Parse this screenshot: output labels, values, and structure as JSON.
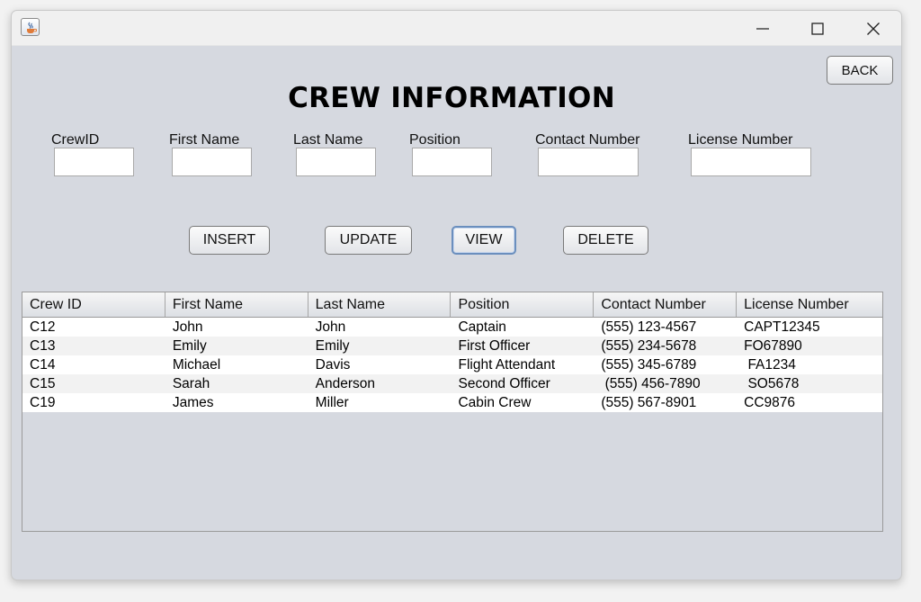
{
  "form": {
    "title": "CREW INFORMATION",
    "back_label": "BACK",
    "fields": [
      {
        "label": "CrewID",
        "value": ""
      },
      {
        "label": "First Name",
        "value": ""
      },
      {
        "label": "Last Name",
        "value": ""
      },
      {
        "label": "Position",
        "value": ""
      },
      {
        "label": "Contact Number",
        "value": ""
      },
      {
        "label": "License Number",
        "value": ""
      }
    ],
    "buttons": {
      "insert": "INSERT",
      "update": "UPDATE",
      "view": "VIEW",
      "delete": "DELETE"
    }
  },
  "table": {
    "columns": [
      "Crew ID",
      "First Name",
      "Last Name",
      "Position",
      "Contact Number",
      "License Number"
    ],
    "rows": [
      [
        "C12",
        "John",
        "John",
        "Captain",
        "(555) 123-4567",
        "CAPT12345"
      ],
      [
        "C13",
        "Emily",
        "Emily",
        "First Officer",
        "(555) 234-5678",
        "FO67890"
      ],
      [
        "C14",
        "Michael",
        "Davis",
        "Flight Attendant",
        "(555) 345-6789",
        " FA1234"
      ],
      [
        "C15",
        "Sarah",
        "Anderson",
        "Second Officer",
        " (555) 456-7890",
        " SO5678"
      ],
      [
        "C19",
        "James",
        "Miller",
        "Cabin Crew",
        "(555) 567-8901",
        "CC9876"
      ]
    ]
  }
}
